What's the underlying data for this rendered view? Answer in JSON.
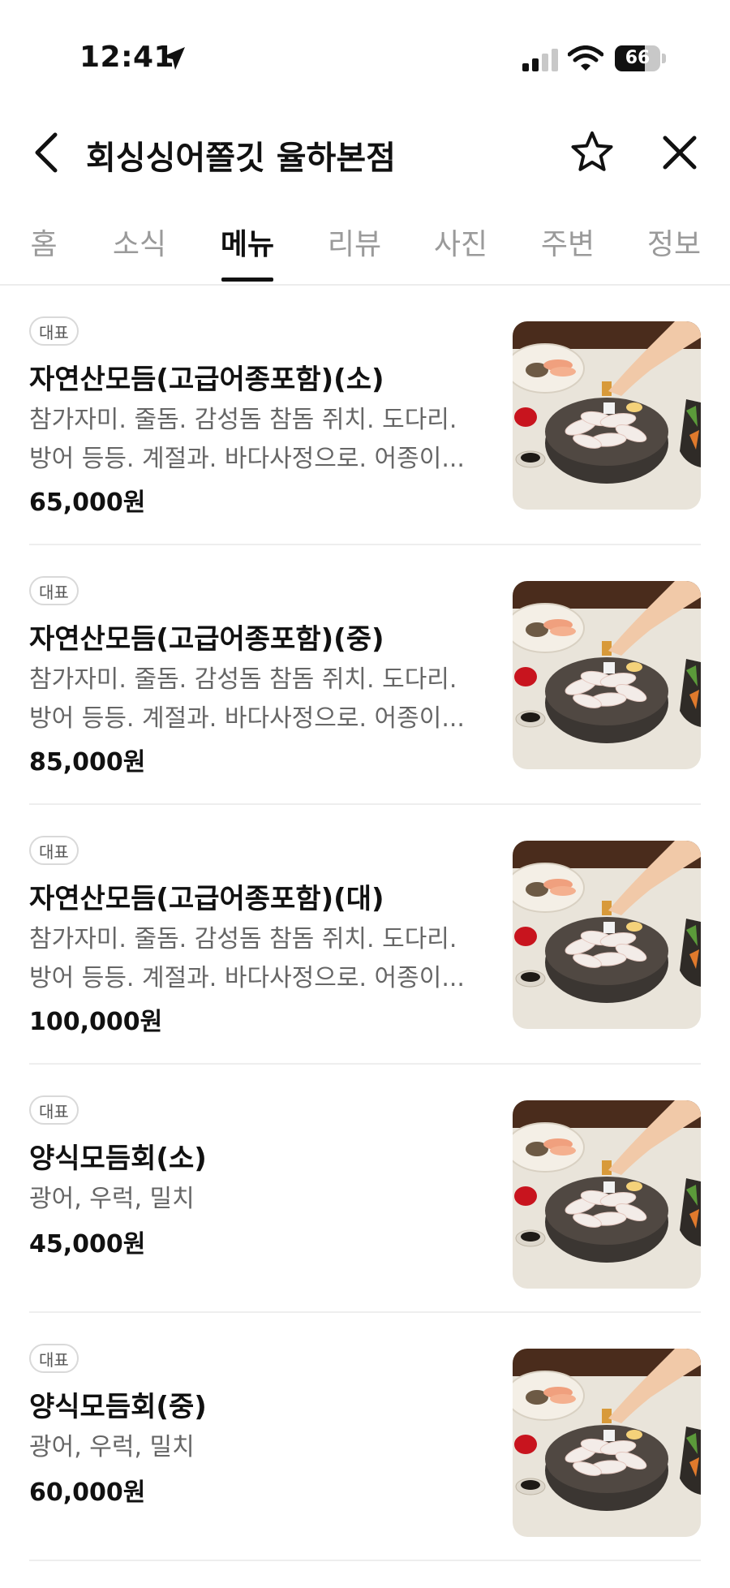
{
  "status_bar": {
    "time": "12:41",
    "battery_level": "66",
    "battery_fraction": 0.66,
    "icons": [
      "location-arrow-icon",
      "signal-icon",
      "wifi-icon",
      "battery-icon"
    ]
  },
  "header": {
    "title": "회싱싱어쫄깃 율하본점",
    "icons": [
      "back-chevron-icon",
      "star-outline-icon",
      "close-x-icon"
    ]
  },
  "tabs": {
    "items": [
      "홈",
      "소식",
      "메뉴",
      "리뷰",
      "사진",
      "주변",
      "정보"
    ],
    "active": "메뉴"
  },
  "menu": [
    {
      "badge": "대표",
      "name": "자연산모듬(고급어종포함)(소)",
      "desc_line1": "참가자미. 줄돔. 감성돔 참돔 쥐치. 도다리.",
      "desc_line2": "방어 등등. 계절과. 바다사정으로. 어종이...",
      "price": "65,000원"
    },
    {
      "badge": "대표",
      "name": "자연산모듬(고급어종포함)(중)",
      "desc_line1": "참가자미. 줄돔. 감성돔 참돔 쥐치. 도다리.",
      "desc_line2": "방어 등등. 계절과. 바다사정으로. 어종이...",
      "price": "85,000원"
    },
    {
      "badge": "대표",
      "name": "자연산모듬(고급어종포함)(대)",
      "desc_line1": "참가자미. 줄돔. 감성돔 참돔 쥐치. 도다리.",
      "desc_line2": "방어 등등. 계절과. 바다사정으로. 어종이...",
      "price": "100,000원"
    },
    {
      "badge": "대표",
      "name": "양식모듬회(소)",
      "desc_line1": "광어, 우럭, 밀치",
      "desc_line2": "",
      "price": "45,000원"
    },
    {
      "badge": "대표",
      "name": "양식모듬회(중)",
      "desc_line1": "광어, 우럭, 밀치",
      "desc_line2": "",
      "price": "60,000원"
    }
  ],
  "colors": {
    "text_primary": "#111111",
    "text_secondary": "#666666",
    "tab_inactive": "#9a9a9a",
    "divider": "#eeeeee"
  }
}
